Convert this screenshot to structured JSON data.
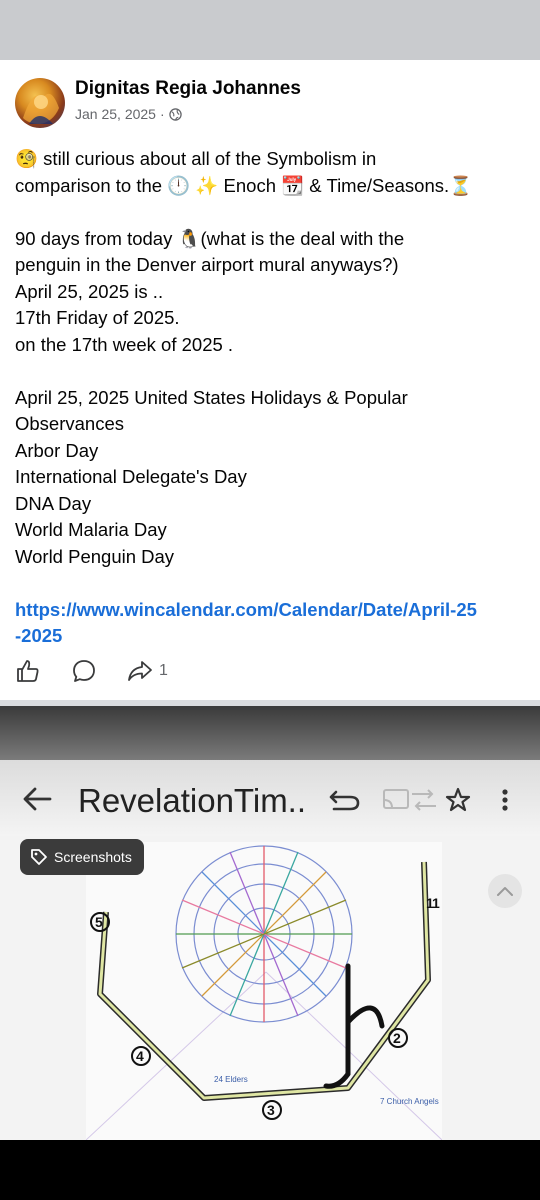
{
  "post": {
    "author": "Dignitas Regia Johannes",
    "date": "Jan 25, 2025",
    "separator": "·",
    "privacy_icon": "globe-icon",
    "lines": [
      "🧐 still curious about all of the Symbolism in",
      "comparison to the 🕛 ✨ Enoch 📆 & Time/Seasons.⏳",
      "",
      "90 days from today 🐧(what is the deal with the",
      "penguin in the Denver airport mural anyways?)",
      "April 25, 2025 is ..",
      "17th Friday of 2025.",
      "on the 17th week of 2025 .",
      "",
      "April 25, 2025 United States Holidays & Popular",
      "Observances",
      "Arbor Day",
      "International Delegate's Day",
      "DNA Day",
      "World Malaria Day",
      "World Penguin Day",
      ""
    ],
    "link_lines": [
      "https://www.wincalendar.com/Calendar/Date/April-25",
      "-2025"
    ],
    "actions": {
      "like_icon": "thumbs-up-icon",
      "comment_icon": "comment-icon",
      "share_icon": "share-icon",
      "share_count": "1"
    }
  },
  "screenshot": {
    "title": "RevelationTim..",
    "chip_label": "Screenshots",
    "icons": [
      "back-arrow-icon",
      "undo-icon",
      "cast-icon",
      "star-icon",
      "more-vertical-icon",
      "scroll-up-icon",
      "tag-icon"
    ],
    "diagram_labels": [
      "1",
      "2",
      "3",
      "4",
      "5",
      "24 Elders",
      "7 Church Angels"
    ]
  }
}
